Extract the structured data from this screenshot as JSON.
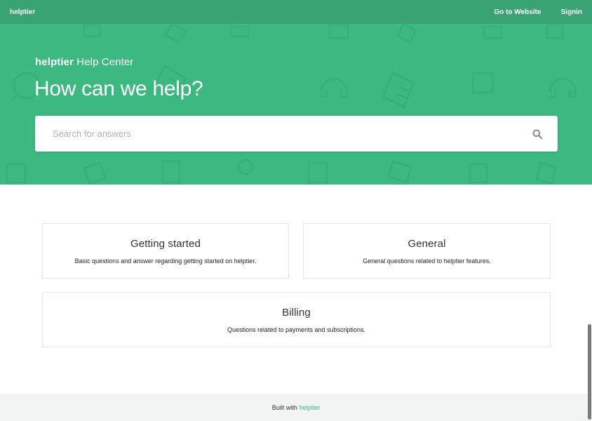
{
  "topbar": {
    "brand": "helptier",
    "nav": [
      "Go to Website",
      "Signin"
    ]
  },
  "hero": {
    "brand_name": "helptier",
    "center_label": "Help Center",
    "title": "How can we help?",
    "search_placeholder": "Search for answers",
    "search_icon": "search-icon"
  },
  "categories": [
    {
      "title": "Getting started",
      "description": "Basic questions and answer regarding getting started on helptier."
    },
    {
      "title": "General",
      "description": "General questions related to helptier features."
    },
    {
      "title": "Billing",
      "description": "Questions related to payments and subscriptions."
    }
  ],
  "footer": {
    "prefix": "Built with",
    "link": "helptier"
  },
  "colors": {
    "topbar": "#3aa374",
    "hero": "#3cb881",
    "footer_bg": "#f1f4f3",
    "link": "#3cb881"
  }
}
